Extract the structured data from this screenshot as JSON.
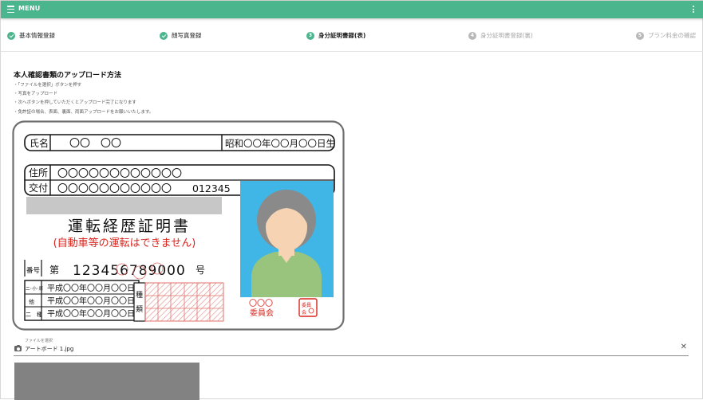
{
  "header": {
    "menu_label": "MENU"
  },
  "steps": [
    {
      "num": "1",
      "label": "基本情報登録",
      "state": "done"
    },
    {
      "num": "2",
      "label": "顔写真登録",
      "state": "done"
    },
    {
      "num": "3",
      "label": "身分証明書録(表)",
      "state": "active"
    },
    {
      "num": "4",
      "label": "身分証明書登録(裏)",
      "state": "pending"
    },
    {
      "num": "5",
      "label": "プラン料金の確認",
      "state": "pending"
    }
  ],
  "section": {
    "title": "本人確認書類のアップロード方法",
    "instructions": [
      "・「ファイルを選択」ボタンを押す",
      "・写真をアップロード",
      "・次へボタンを押していただくとアップロード完了になります",
      "・免許証の場合、表面、裏面、両面アップロードをお願いいたします。"
    ]
  },
  "license": {
    "name_label": "氏名",
    "name_value": "〇〇　〇〇",
    "birth": "昭和〇〇年〇〇月〇〇日生",
    "address_label": "住所",
    "address_value": "〇〇〇〇〇〇〇〇〇〇〇〇",
    "issue_label": "交付",
    "issue_value": "〇〇〇〇〇〇〇〇〇〇〇",
    "issue_number": "012345",
    "title": "運転経歴証明書",
    "subtitle": "(自動車等の運転はできません)",
    "number_label": "番号",
    "number_prefix": "第",
    "number_value": "123456789000",
    "number_suffix": "号",
    "cat_labels": [
      "二･小･原",
      "他",
      "二　種"
    ],
    "dates": [
      "平成〇〇年〇〇月〇〇日",
      "平成〇〇年〇〇月〇〇日",
      "平成〇〇年〇〇月〇〇日"
    ],
    "type_label_1": "種",
    "type_label_2": "類",
    "issuer_mark": "〇〇〇",
    "issuer_name": "委員会",
    "seal_text": "委員会印"
  },
  "upload": {
    "label": "ファイルを選択",
    "filename": "アートボード 1.jpg"
  },
  "colors": {
    "accent": "#4bb58e",
    "pending": "#b8b8b8",
    "license_red": "#d9251d",
    "photo_bg": "#3fb6e6"
  }
}
